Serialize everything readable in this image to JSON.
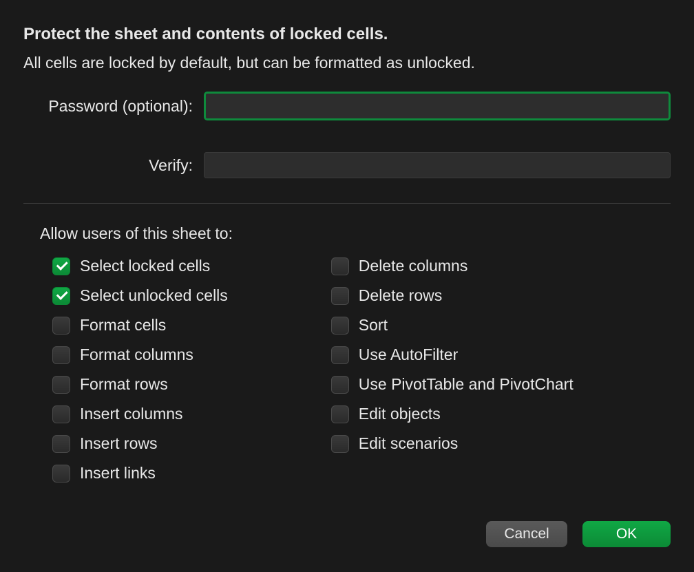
{
  "title": "Protect the sheet and contents of locked cells.",
  "subtitle": "All cells are locked by default, but can be formatted as unlocked.",
  "password_label": "Password (optional):",
  "verify_label": "Verify:",
  "password_value": "",
  "verify_value": "",
  "section_label": "Allow users of this sheet to:",
  "permissions_left": [
    {
      "label": "Select locked cells",
      "checked": true
    },
    {
      "label": "Select unlocked cells",
      "checked": true
    },
    {
      "label": "Format cells",
      "checked": false
    },
    {
      "label": "Format columns",
      "checked": false
    },
    {
      "label": "Format rows",
      "checked": false
    },
    {
      "label": "Insert columns",
      "checked": false
    },
    {
      "label": "Insert rows",
      "checked": false
    },
    {
      "label": "Insert links",
      "checked": false
    }
  ],
  "permissions_right": [
    {
      "label": "Delete columns",
      "checked": false
    },
    {
      "label": "Delete rows",
      "checked": false
    },
    {
      "label": "Sort",
      "checked": false
    },
    {
      "label": "Use AutoFilter",
      "checked": false
    },
    {
      "label": "Use PivotTable and PivotChart",
      "checked": false
    },
    {
      "label": "Edit objects",
      "checked": false
    },
    {
      "label": "Edit scenarios",
      "checked": false
    }
  ],
  "buttons": {
    "cancel": "Cancel",
    "ok": "OK"
  }
}
